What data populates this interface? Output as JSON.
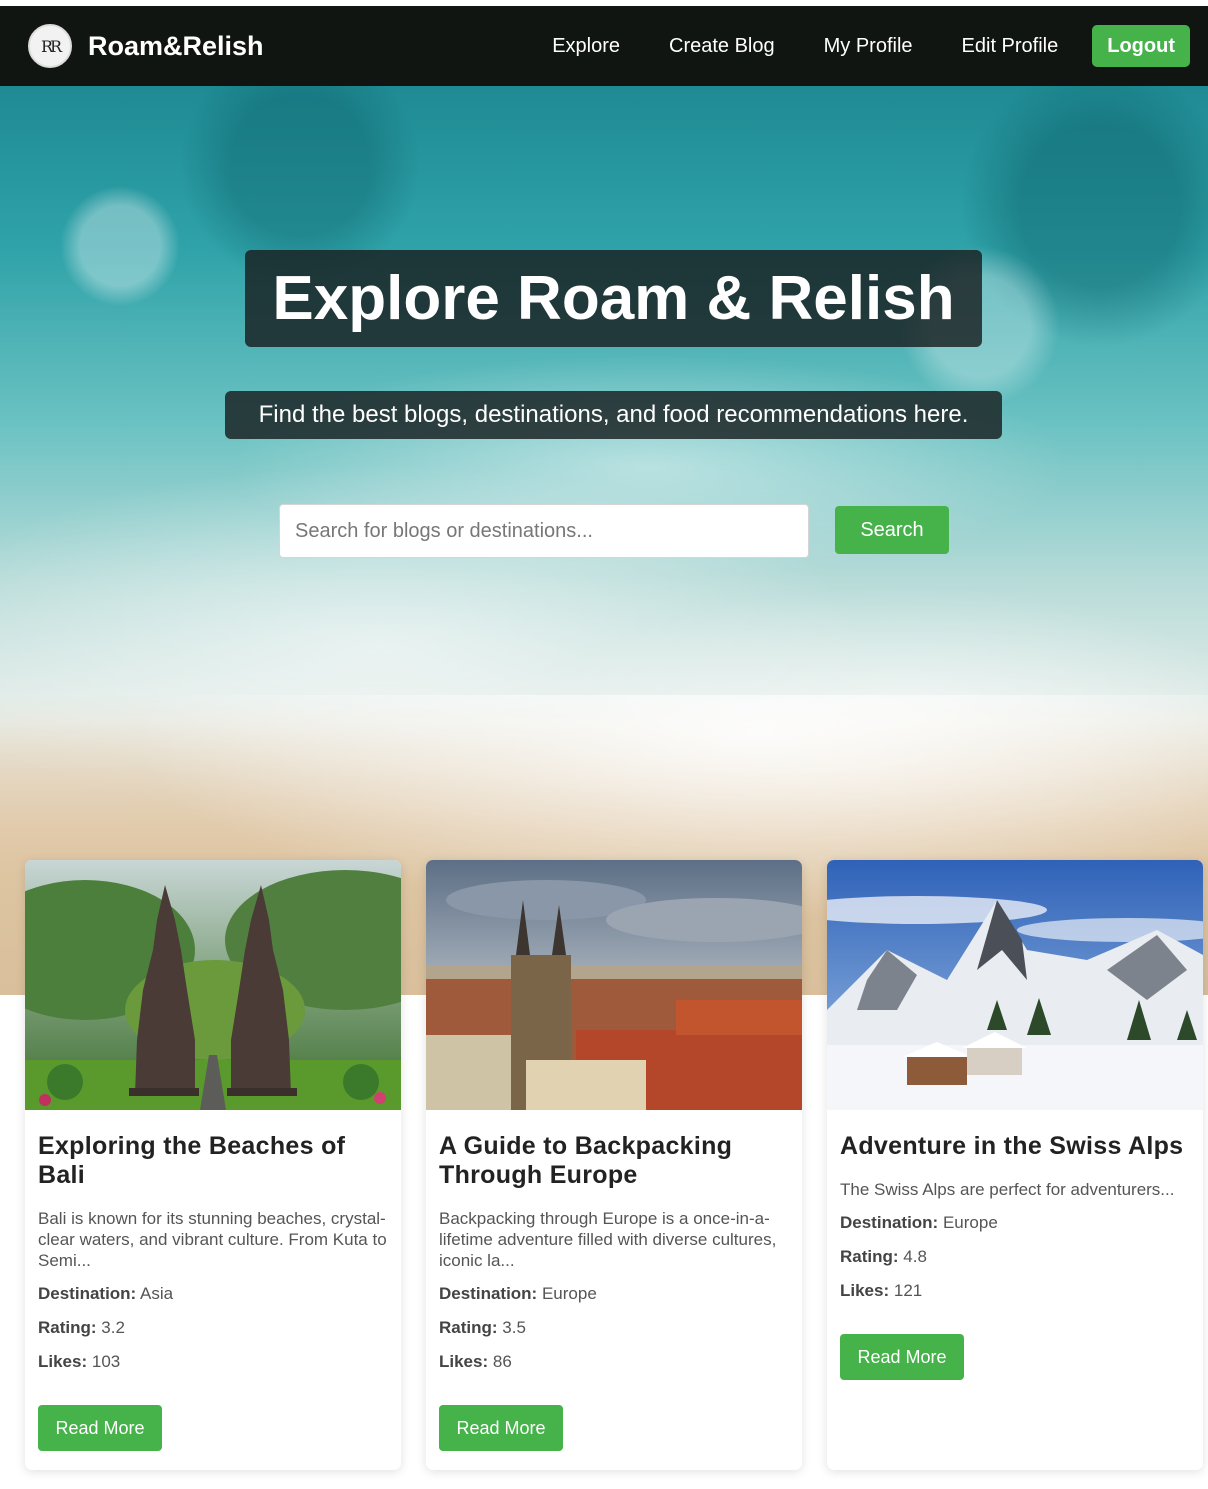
{
  "nav": {
    "logo_text": "RR",
    "brand": "Roam&Relish",
    "links": [
      "Explore",
      "Create Blog",
      "My Profile",
      "Edit Profile"
    ],
    "logout": "Logout"
  },
  "hero": {
    "title": "Explore Roam & Relish",
    "subtitle": "Find the best blogs, destinations, and food recommendations here.",
    "search_placeholder": "Search for blogs or destinations...",
    "search_button": "Search"
  },
  "cards": [
    {
      "title": "Exploring the Beaches of Bali",
      "excerpt": "Bali is known for its stunning beaches, crystal-clear waters, and vibrant culture. From Kuta to Semi...",
      "destination_label": "Destination:",
      "destination": "Asia",
      "rating_label": "Rating:",
      "rating": "3.2",
      "likes_label": "Likes:",
      "likes": "103",
      "button": "Read More"
    },
    {
      "title": "A Guide to Backpacking Through Europe",
      "excerpt": "Backpacking through Europe is a once-in-a-lifetime adventure filled with diverse cultures, iconic la...",
      "destination_label": "Destination:",
      "destination": "Europe",
      "rating_label": "Rating:",
      "rating": "3.5",
      "likes_label": "Likes:",
      "likes": "86",
      "button": "Read More"
    },
    {
      "title": "Adventure in the Swiss Alps",
      "excerpt": "The Swiss Alps are perfect for adventurers...",
      "destination_label": "Destination:",
      "destination": "Europe",
      "rating_label": "Rating:",
      "rating": "4.8",
      "likes_label": "Likes:",
      "likes": "121",
      "button": "Read More"
    }
  ],
  "colors": {
    "accent": "#46b24a",
    "navbar": "#111512"
  }
}
